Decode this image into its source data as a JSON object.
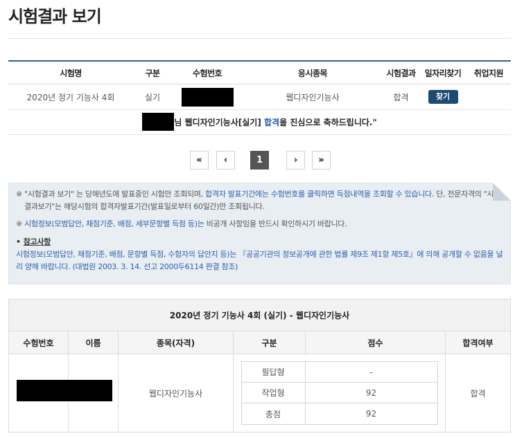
{
  "page": {
    "title": "시험결과 보기"
  },
  "result_table": {
    "headers": [
      "시험명",
      "구분",
      "수험번호",
      "응시종목",
      "시험결과",
      "일자리찾기",
      "취업지원"
    ],
    "row": {
      "exam": "2020년 정기 기능사 4회",
      "type": "실기",
      "subject": "웹디자인기능사",
      "result": "합격",
      "find_button": "찾기"
    }
  },
  "congrats": {
    "name_suffix": "님 웹디자인기능사[실기]",
    "pass": "합격",
    "tail": "을 진심으로 축하드립니다.\""
  },
  "pagination": {
    "first": "«",
    "prev": "‹",
    "current": "1",
    "next": "›",
    "last": "»"
  },
  "notice": {
    "line1_a": "※ \"시험결과 보기\" 는 당해년도에 발표중인 시험만 조회되며, ",
    "line1_b": "합격자 발표기간에는 수험번호를 클릭하면 득점내역을 조회할 수 있습니다.",
    "line1_c": " 단, 전문자격의 \"시험결과보기\"는 해당시험의 합격자발표기간(발표일로부터 60일간)만 조회됩니다.",
    "line2_a": "※ ",
    "line2_b": "시험정보(모범답안, 채점기준, 배점, 세부문항별 득점 등)는",
    "line2_c": " 비공개 사항임을 반드시 확인하시기 바랍니다.",
    "ref_title": "참고사항",
    "ref_a": "시험정보(모범답안, 채점기준, 배점, 문항별 득점, 수험자의 답안지 등)는 『공공기관의 정보공개에 관한 법률 제9조 제1항 제5호』에 의해 공개할 수 없음을 널리 양해 바랍니다.",
    "ref_b": " (대법원 2003. 3. 14. 선고 2000두6114 판결 참조)"
  },
  "score": {
    "title": "2020년 정기 기능사 4회 (실기) - 웹디자인기능사",
    "headers": [
      "수험번호",
      "이름",
      "종목(자격)",
      "구분",
      "점수",
      "합격여부"
    ],
    "subject": "웹디자인기능사",
    "rows": [
      {
        "label": "필답형",
        "value": "-"
      },
      {
        "label": "작업형",
        "value": "92"
      },
      {
        "label": "총점",
        "value": "92"
      }
    ],
    "result": "합격"
  },
  "colors": {
    "accent": "#2f5f8a",
    "button": "#1c4a70",
    "link": "#2a5fae",
    "notice_bg": "#e9eef3"
  }
}
